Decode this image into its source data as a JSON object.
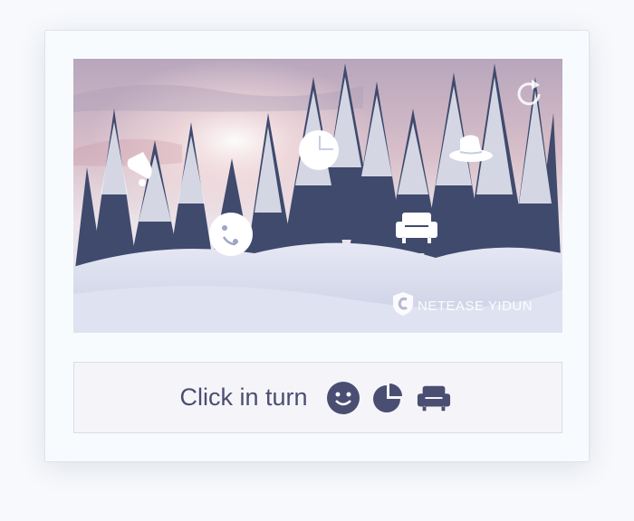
{
  "captcha": {
    "instruction_text": "Click in turn",
    "hint_icons": [
      "smiley-icon",
      "pie-chart-icon",
      "sofa-icon"
    ],
    "targets": [
      "bell-icon",
      "pie-chart-icon",
      "hat-icon",
      "smiley-icon",
      "sofa-icon"
    ],
    "watermark": "NETEASE YIDUN",
    "refresh_icon": "refresh-icon"
  },
  "colors": {
    "accent": "#4a4e72",
    "card_background": "#f8fbfd",
    "instruction_background": "#f5f5f9"
  }
}
